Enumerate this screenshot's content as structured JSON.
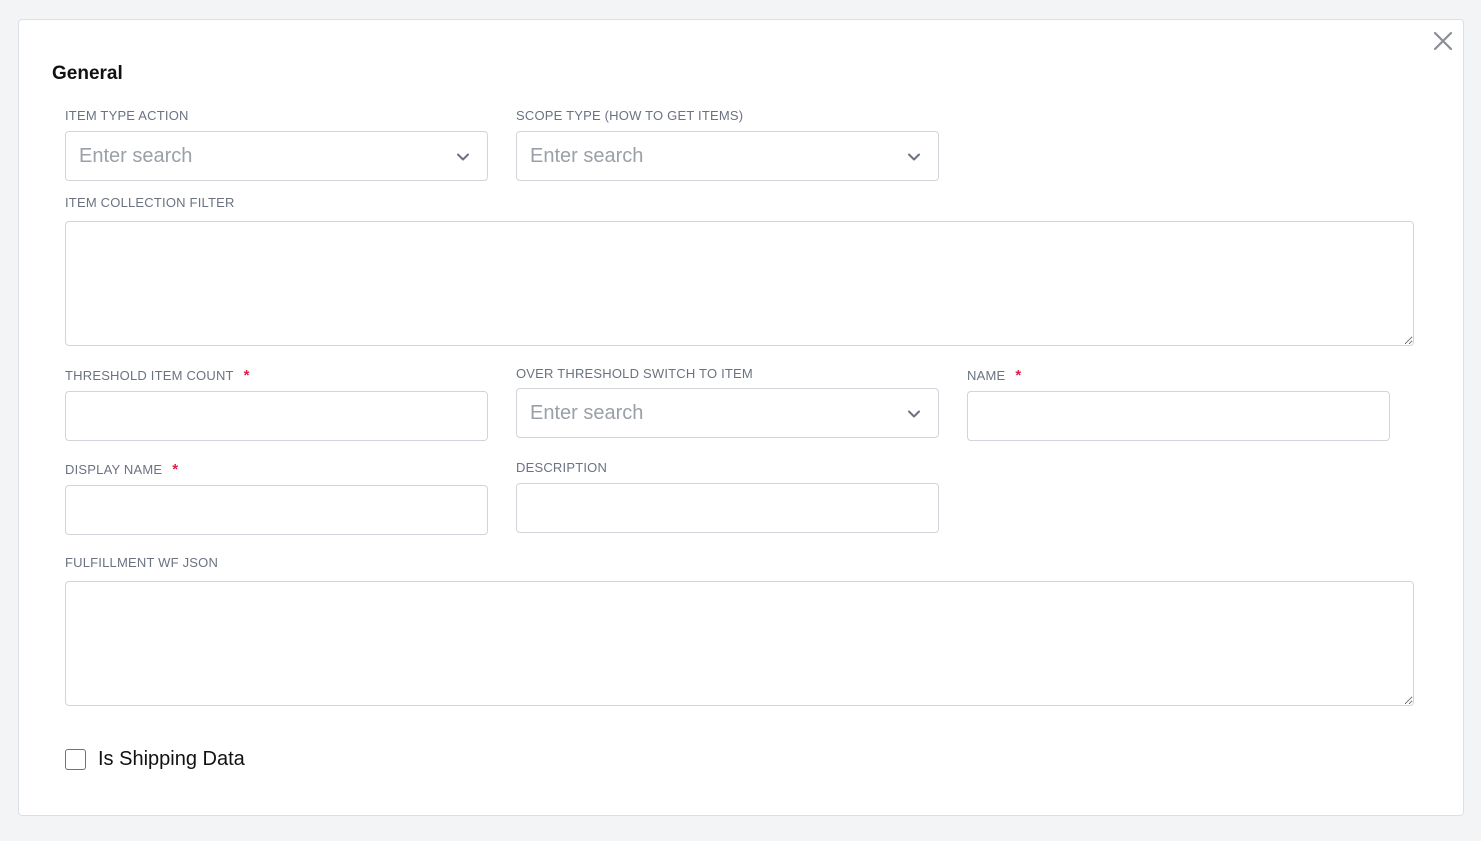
{
  "section": {
    "title": "General"
  },
  "fields": {
    "item_type_action": {
      "label": "ITEM TYPE ACTION",
      "placeholder": "Enter search"
    },
    "scope_type": {
      "label": "SCOPE TYPE (HOW TO GET ITEMS)",
      "placeholder": "Enter search"
    },
    "item_collection_filter": {
      "label": "ITEM COLLECTION FILTER",
      "value": ""
    },
    "threshold_item_count": {
      "label": "THRESHOLD ITEM COUNT",
      "required_mark": "*",
      "value": ""
    },
    "over_threshold_switch": {
      "label": "OVER THRESHOLD SWITCH TO ITEM",
      "placeholder": "Enter search"
    },
    "name": {
      "label": "NAME",
      "required_mark": "*",
      "value": ""
    },
    "display_name": {
      "label": "DISPLAY NAME",
      "required_mark": "*",
      "value": ""
    },
    "description": {
      "label": "DESCRIPTION",
      "value": ""
    },
    "fulfillment_wf_json": {
      "label": "FULFILLMENT WF JSON",
      "value": ""
    }
  },
  "checkbox": {
    "label": "Is Shipping Data",
    "checked": false
  },
  "icons": {
    "close": "close-icon",
    "dropdown": "chevron-down-icon"
  },
  "colors": {
    "required": "#e11d48",
    "border": "#d1d5db",
    "background": "#f3f4f6"
  }
}
